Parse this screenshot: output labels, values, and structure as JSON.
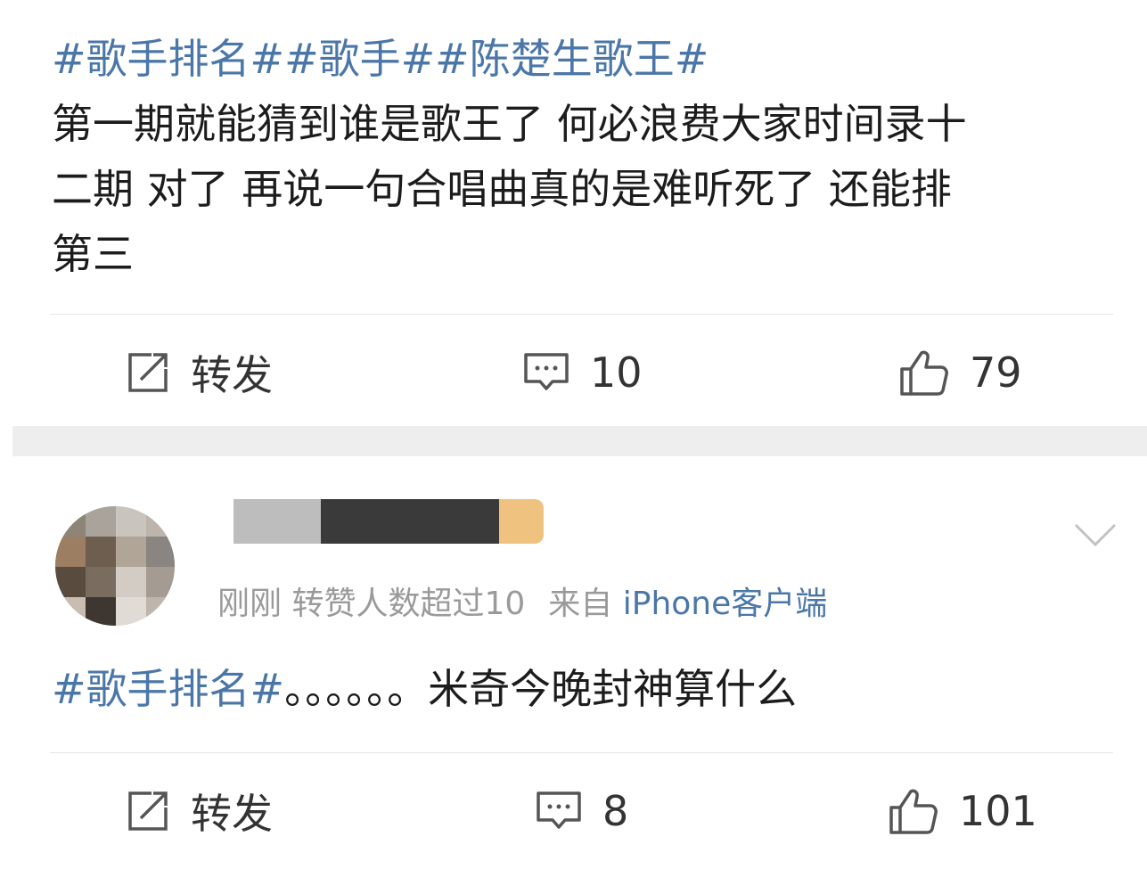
{
  "posts": [
    {
      "hashtags": "#歌手排名##歌手##陈楚生歌王#",
      "body_line1": "第一期就能猜到谁是歌王了 何必浪费大家时间录十",
      "body_line2": "二期 对了 再说一句合唱曲真的是难听死了 还能排",
      "body_line3": "第三",
      "actions": {
        "repost_label": "转发",
        "comment_count": "10",
        "like_count": "79"
      }
    },
    {
      "meta_time": "刚刚",
      "meta_note": "转赞人数超过10",
      "meta_from": "来自",
      "meta_source": "iPhone客户端",
      "hashtag": "#歌手排名#",
      "body": "。。。。。。米奇今晚封神算什么",
      "actions": {
        "repost_label": "转发",
        "comment_count": "8",
        "like_count": "101"
      }
    }
  ],
  "icons": {
    "repost": "repost-icon",
    "comment": "comment-icon",
    "like": "thumbs-up-icon",
    "menu": "chevron-down-icon"
  },
  "colors": {
    "link": "#4b77a8",
    "text": "#1c1c1c",
    "meta": "#9a9a9a",
    "separator": "#eeeeee"
  }
}
